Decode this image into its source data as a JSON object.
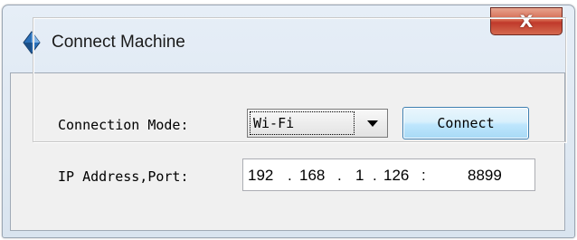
{
  "window": {
    "title": "Connect Machine",
    "close_label": "X",
    "app_icon": "blue-diamond-icon"
  },
  "form": {
    "connection_mode_label": "Connection Mode:",
    "connection_mode_value": "Wi-Fi",
    "connect_label": "Connect",
    "ip_port_label": "IP Address,Port:",
    "ip_octets": [
      "192",
      "168",
      "1",
      "126"
    ],
    "ip_dot": ".",
    "port_separator": ":",
    "port": "8899"
  },
  "colors": {
    "close_button": "#c0392b",
    "connect_button": "#bee6fd",
    "title_bar": "#dce6f0"
  }
}
